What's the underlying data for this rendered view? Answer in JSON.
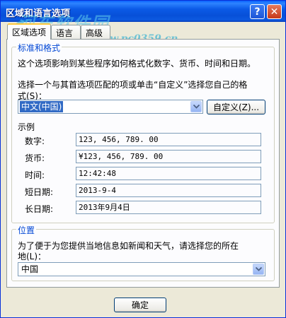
{
  "window": {
    "title": "区域和语言选项",
    "help_label": "?",
    "close_label": "✕",
    "watermark": "河东软件园",
    "watermark_url": "www.pc0359.cn"
  },
  "tabs": [
    {
      "label": "区域选项"
    },
    {
      "label": "语言"
    },
    {
      "label": "高级"
    }
  ],
  "standards": {
    "title": "标准和格式",
    "description": "这个选项影响到某些程序如何格式化数字、货币、时间和日期。",
    "instruction_line1": "选择一个与其首选项匹配的项或单击“自定义”选择您自己的格",
    "instruction_line2": "式(S)：",
    "locale_value": "中文(中国)",
    "customize_label": "自定义(Z)..."
  },
  "samples": {
    "title": "示例",
    "rows": [
      {
        "label": "数字:",
        "value": "123, 456, 789. 00"
      },
      {
        "label": "货币:",
        "value": "¥123, 456, 789. 00"
      },
      {
        "label": "时间:",
        "value": "12:42:48"
      },
      {
        "label": "短日期:",
        "value": "2013-9-4"
      },
      {
        "label": "长日期:",
        "value": "2013年9月4日"
      }
    ]
  },
  "location": {
    "title": "位置",
    "description_line1": "为了便于为您提供当地信息如新闻和天气，请选择您的所在",
    "description_line2": "地(L)：",
    "value": "中国"
  },
  "footer": {
    "ok_label": "确定"
  }
}
